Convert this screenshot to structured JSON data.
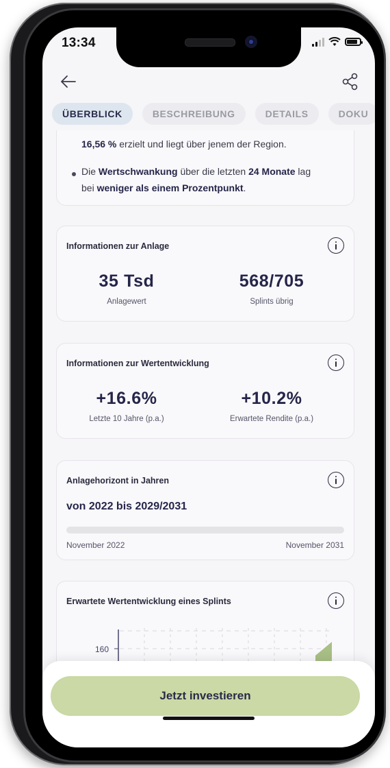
{
  "status_bar": {
    "time": "13:34"
  },
  "nav": {
    "back_icon": "arrow-left-icon",
    "share_icon": "share-icon"
  },
  "tabs": [
    {
      "label": "ÜBERBLICK",
      "active": true
    },
    {
      "label": "BESCHREIBUNG",
      "active": false
    },
    {
      "label": "DETAILS",
      "active": false
    },
    {
      "label": "DOKU",
      "active": false
    }
  ],
  "summary": {
    "line1_value": "16,56 %",
    "line1_rest": " erzielt und liegt über jenem der Region.",
    "bullet_prefix": "Die ",
    "bullet_term": "Wertschwankung",
    "bullet_mid": " über die letzten ",
    "bullet_period": "24 Monate",
    "bullet_tail": " lag",
    "line3_prefix": "bei ",
    "line3_emph": "weniger als einem Prozentpunkt",
    "line3_end": "."
  },
  "anlage": {
    "title": "Informationen zur Anlage",
    "value1": "35 Tsd",
    "label1": "Anlagewert",
    "value2": "568/705",
    "label2": "Splints übrig"
  },
  "wertentwicklung": {
    "title": "Informationen zur Wertentwicklung",
    "value1": "+16.6%",
    "label1": "Letzte 10 Jahre (p.a.)",
    "value2": "+10.2%",
    "label2": "Erwartete Rendite (p.a.)"
  },
  "horizont": {
    "title": "Anlagehorizont in Jahren",
    "range_text": "von 2022 bis 2029/2031",
    "start_label": "November 2022",
    "end_label": "November 2031",
    "progress_fraction": 0.0
  },
  "chart_card": {
    "title": "Erwartete Wertentwicklung eines Splints",
    "y_tick": "160"
  },
  "cta": {
    "label": "Jetzt investieren"
  },
  "colors": {
    "accent": "#cad9a5",
    "text_dark": "#25254a",
    "tab_active_bg": "#dde6ef"
  }
}
